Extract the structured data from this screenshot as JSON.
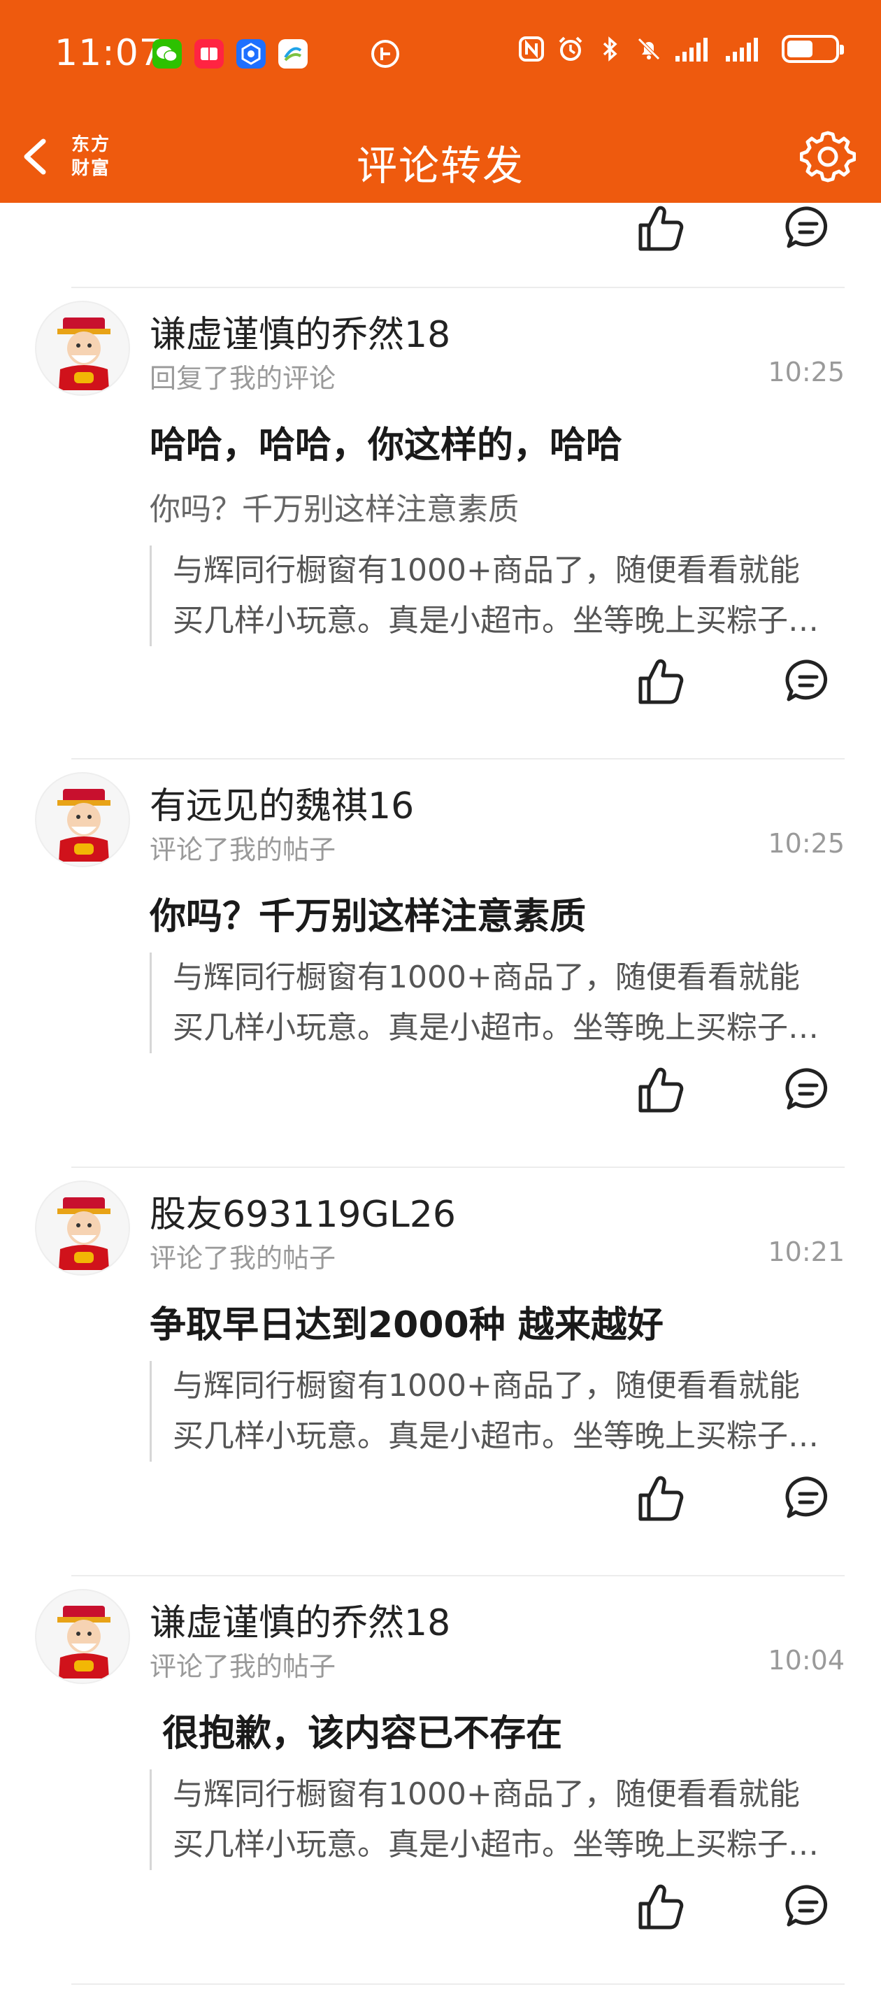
{
  "status_bar": {
    "time": "11:07",
    "apps": [
      {
        "name": "wechat-icon",
        "color": "#2DC100"
      },
      {
        "name": "red-app-icon",
        "color": "#FF2442"
      },
      {
        "name": "blue-app-icon",
        "color": "#1E6FFF"
      },
      {
        "name": "china-mobile-icon",
        "color": "#1FA3E8"
      }
    ],
    "battery_level": 0.55
  },
  "header": {
    "title": "评论转发",
    "logo_line1": "东方",
    "logo_line2": "财富",
    "bg_color": "#EE5A0E"
  },
  "items": [
    {
      "username": "谦虚谨慎的乔然18",
      "action": "回复了我的评论",
      "time": "10:25",
      "main_text": "哈哈，哈哈，你这样的，哈哈",
      "sub_text": "你吗？千万别这样注意素质",
      "quote_line1": "与辉同行橱窗有1000+商品了，随便看看就能",
      "quote_line2": "买几样小玩意。真是小超市。坐等晚上买粽子…"
    },
    {
      "username": "有远见的魏祺16",
      "action": "评论了我的帖子",
      "time": "10:25",
      "main_text": "你吗？千万别这样注意素质",
      "quote_line1": "与辉同行橱窗有1000+商品了，随便看看就能",
      "quote_line2": "买几样小玩意。真是小超市。坐等晚上买粽子…"
    },
    {
      "username": "股友693119GL26",
      "action": "评论了我的帖子",
      "time": "10:21",
      "main_text": "争取早日达到2000种  越来越好",
      "quote_line1": "与辉同行橱窗有1000+商品了，随便看看就能",
      "quote_line2": "买几样小玩意。真是小超市。坐等晚上买粽子…"
    },
    {
      "username": "谦虚谨慎的乔然18",
      "action": "评论了我的帖子",
      "time": "10:04",
      "main_text": " 很抱歉，该内容已不存在",
      "quote_line1": "与辉同行橱窗有1000+商品了，随便看看就能",
      "quote_line2": "买几样小玩意。真是小超市。坐等晚上买粽子…"
    }
  ]
}
